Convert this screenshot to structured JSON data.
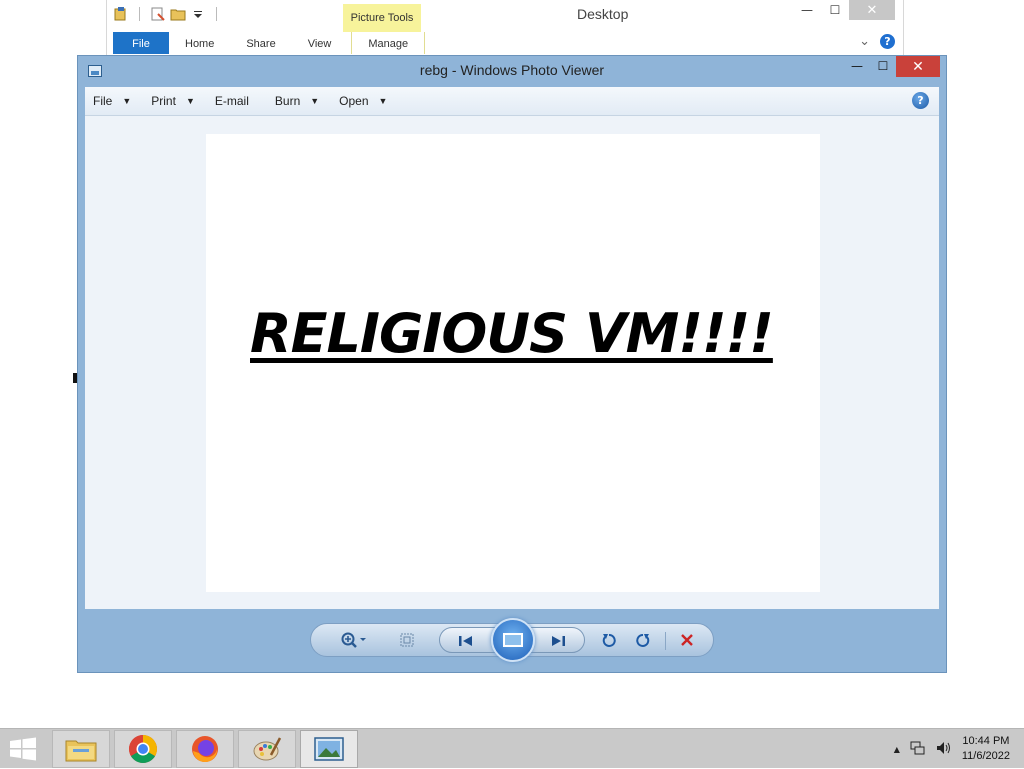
{
  "explorer": {
    "title": "Desktop",
    "contextual_tab_group": "Picture Tools",
    "tabs": [
      "File",
      "Home",
      "Share",
      "View",
      "Manage"
    ],
    "help_label": "?",
    "minimize": "—",
    "maximize": "☐",
    "close": "✕",
    "expand_ribbon": "⌄"
  },
  "viewer": {
    "title": "rebg - Windows Photo Viewer",
    "minimize": "—",
    "maximize": "☐",
    "close": "✕",
    "menu": [
      {
        "label": "File",
        "caret": "▼"
      },
      {
        "label": "Print",
        "caret": "▼"
      },
      {
        "label": "E-mail",
        "caret": ""
      },
      {
        "label": "Burn",
        "caret": "▼"
      },
      {
        "label": "Open",
        "caret": "▼"
      }
    ],
    "help_label": "?",
    "image_text": "RELIGIOUS VM!!!!"
  },
  "taskbar": {
    "time": "10:44 PM",
    "date": "11/6/2022",
    "tray_chevron": "▲"
  },
  "colors": {
    "viewer_frame": "#8fb4d8",
    "close_red": "#c9413a",
    "file_tab_blue": "#1e73c8",
    "picture_tools_yellow": "#f7f39b",
    "taskbar": "#c9c9c9"
  }
}
